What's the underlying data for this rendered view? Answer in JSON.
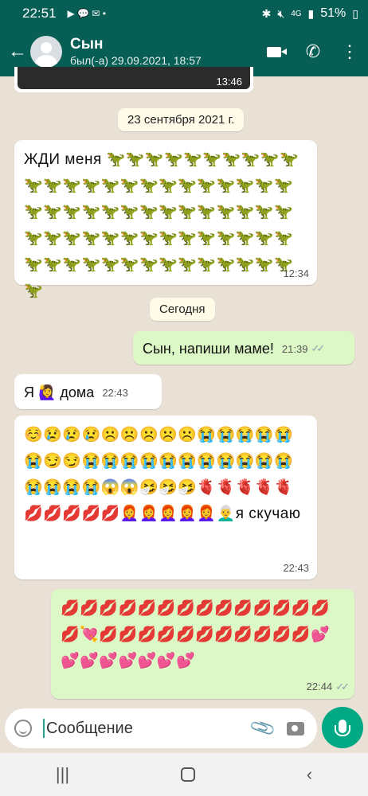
{
  "status_bar": {
    "time": "22:51",
    "notif_icons": "▶ 💬 ✉ •",
    "network": "4G",
    "battery": "51%"
  },
  "header": {
    "back_icon": "←",
    "contact_name": "Сын",
    "last_seen": "был(-а) 29.09.2021, 18:57",
    "call_icon": "✆",
    "menu_icon": "⋮"
  },
  "chat": {
    "prev_image_time": "13:46",
    "date_chip_1": "23 сентября 2021 г.",
    "msg1": {
      "text": "ЖДИ меня 🦖🦖🦖🦖🦖🦖🦖🦖🦖🦖🦖🦖🦖🦖🦖🦖🦖🦖🦖🦖🦖🦖🦖🦖🦖🦖🦖🦖🦖🦖🦖🦖🦖🦖🦖🦖🦖🦖🦖🦖🦖🦖🦖🦖🦖🦖🦖🦖🦖🦖🦖🦖🦖🦖🦖🦖🦖🦖🦖🦖🦖🦖🦖🦖🦖🦖🦖",
      "time": "12:34"
    },
    "date_chip_2": "Сегодня",
    "msg2": {
      "text": "Сын, напиши маме!",
      "time": "21:39",
      "ticks": "✓✓"
    },
    "msg3": {
      "text": "Я 🙋‍♀️ дома",
      "time": "22:43"
    },
    "msg4": {
      "text": "☺️😢😢😢☹️☹️☹️☹️☹️😭😭😭😭😭😭😏😏😭😭😭😭😭😭😭😭😭😭😭😭😭😭😭😱😱🤧🤧🤧🫀🫀🫀🫀🫀💋💋💋💋💋👩‍🦰👩‍🦰👩‍🦰👩‍🦰👩‍🦰👨‍🦳я скучаю",
      "time": "22:43"
    },
    "msg5": {
      "text": "💋💋💋💋💋💋💋💋💋💋💋💋💋💋💋💘💋💋💋💋💋💋💋💋💋💋💋💕💕💕💕💕💕💕💕",
      "time": "22:44",
      "ticks": "✓✓"
    }
  },
  "input": {
    "placeholder": "Сообщение",
    "attach_icon": "📎"
  },
  "navbar": {
    "recents_icon": "|||",
    "back_icon": "‹"
  }
}
